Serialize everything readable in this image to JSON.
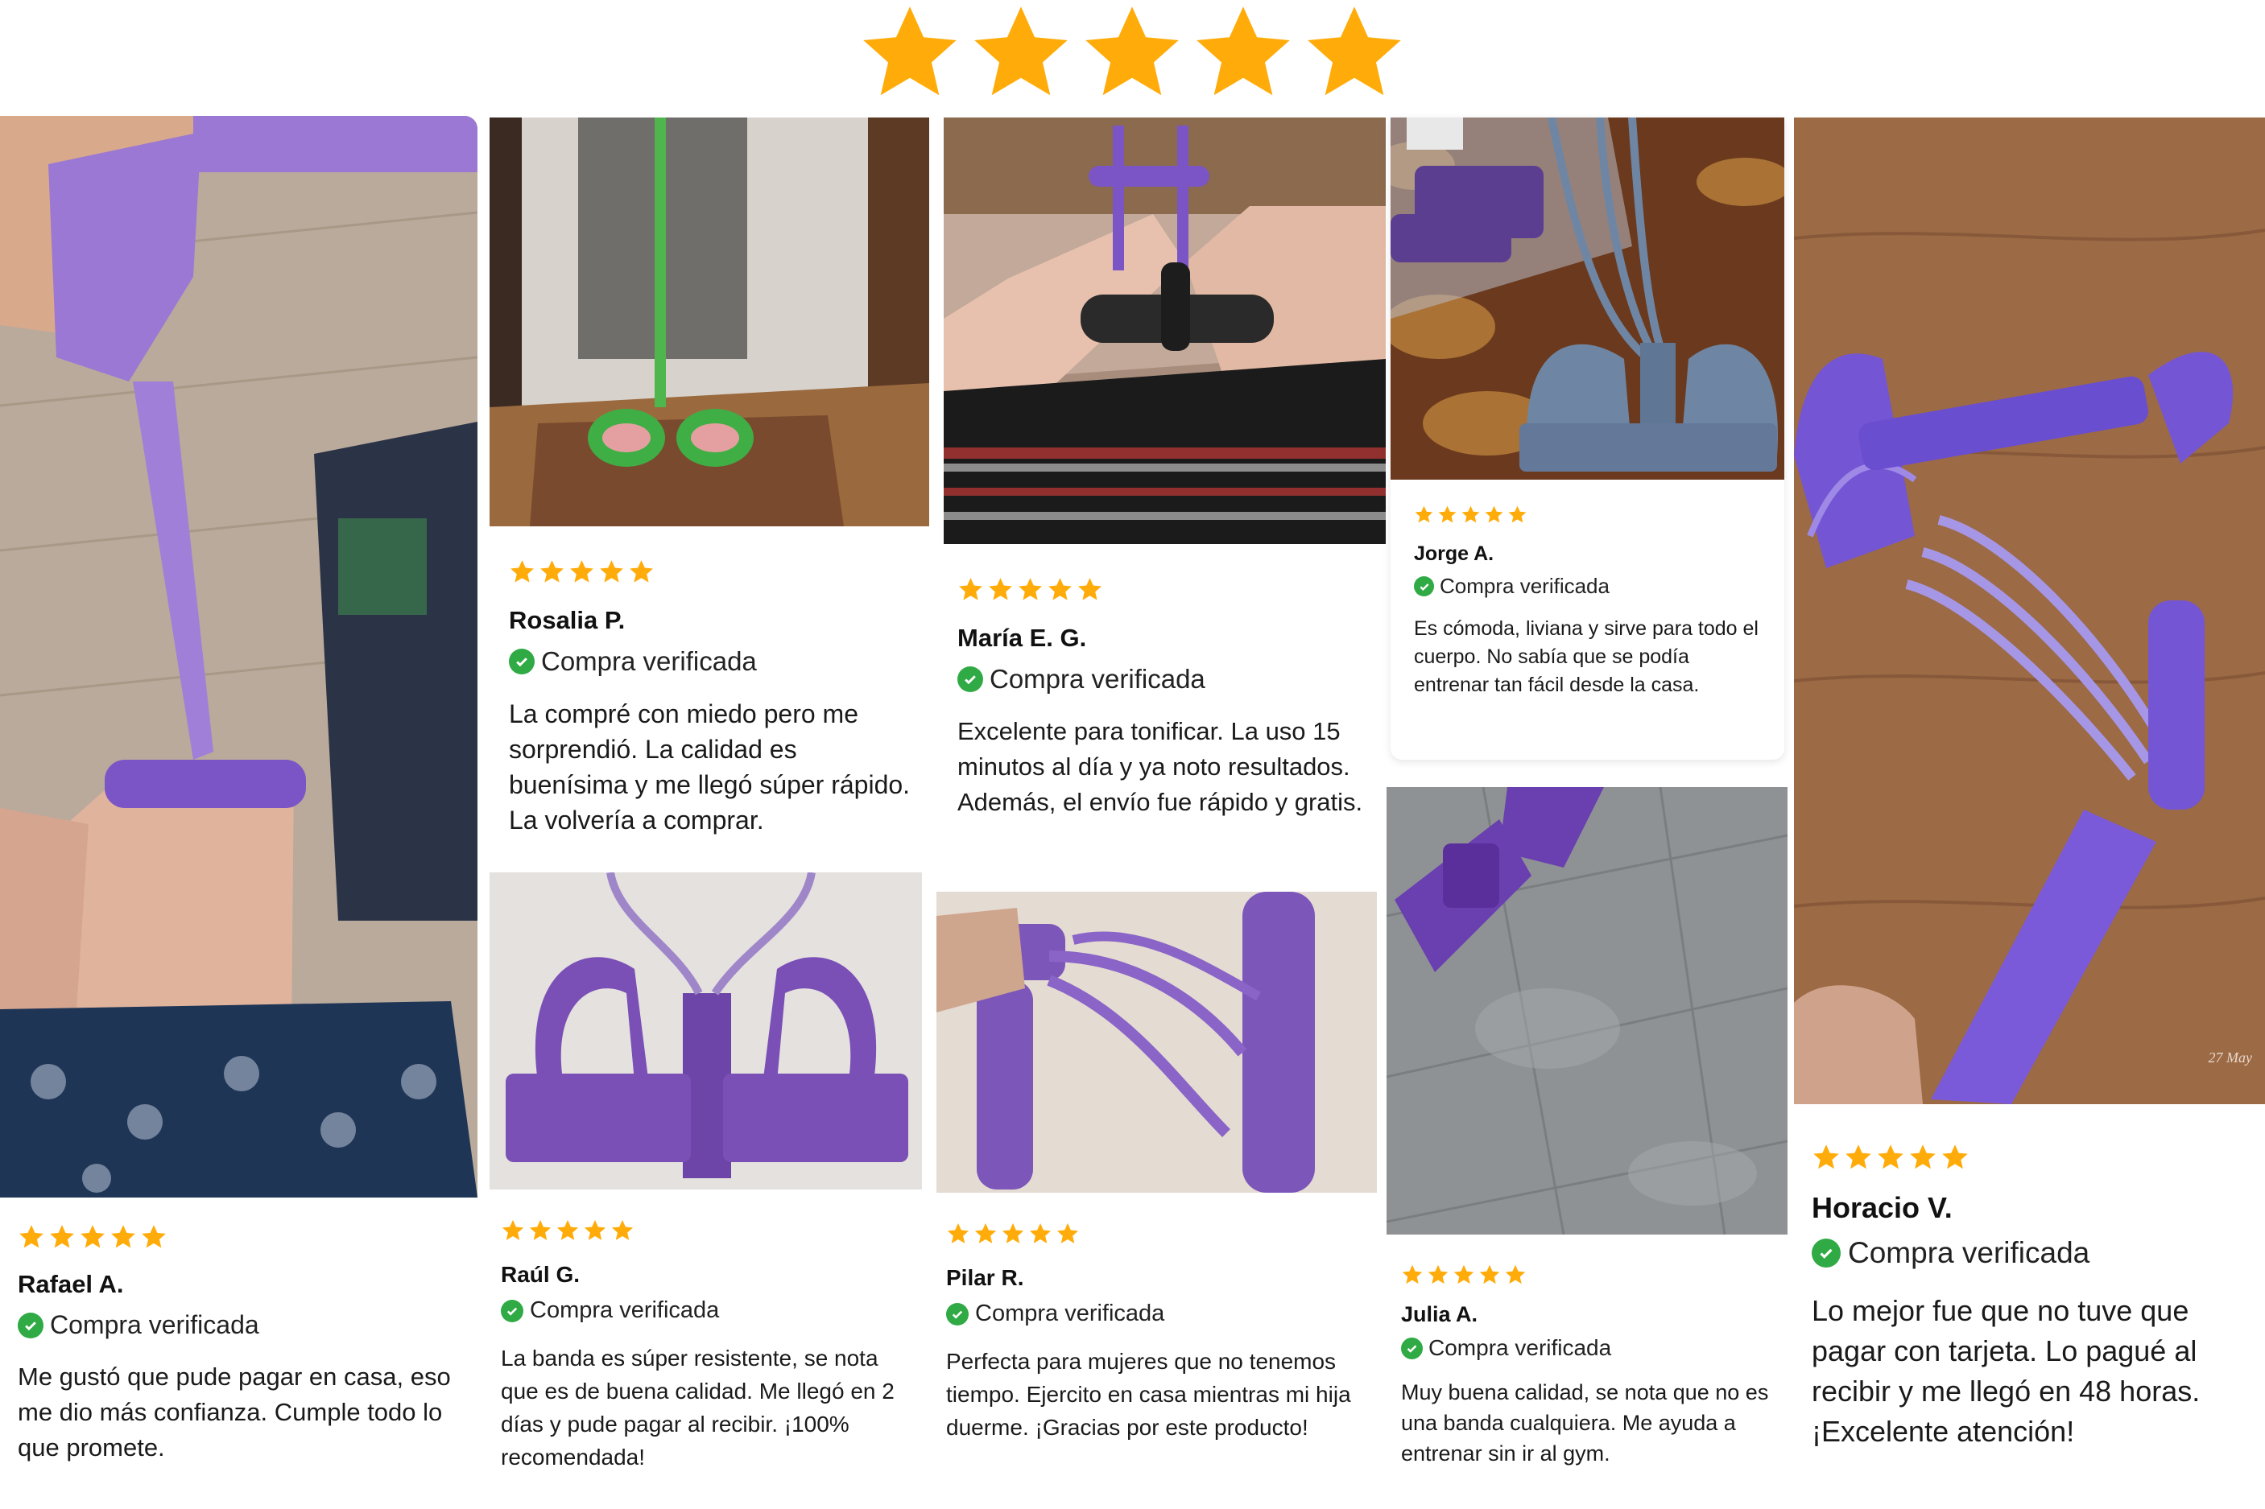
{
  "colors": {
    "star": "#FFAC0A",
    "verified": "#2FAA44",
    "purple": "#7C5BC9"
  },
  "top_rating": {
    "stars": 5,
    "icon": "star-icon"
  },
  "reviews": [
    {
      "rating": 5,
      "name": "Rafael A.",
      "verified": "Compra verificada",
      "text": "Me gustó que pude pagar en casa, eso me dio más confianza. Cumple todo lo que promete."
    },
    {
      "rating": 5,
      "name": "Rosalia P.",
      "verified": "Compra verificada",
      "text": "La compré con miedo pero me sorprendió. La calidad es buenísima y me llegó súper rápido. La volvería a comprar."
    },
    {
      "rating": 5,
      "name": "Raúl G.",
      "verified": "Compra verificada",
      "text": "La banda es súper resistente, se nota que es de buena calidad. Me llegó en 2 días y pude pagar al recibir. ¡100% recomendada!"
    },
    {
      "rating": 5,
      "name": "María E. G.",
      "verified": "Compra verificada",
      "text": "Excelente para tonificar. La uso 15 minutos al día y ya noto resultados. Además, el envío fue rápido y gratis."
    },
    {
      "rating": 5,
      "name": "Pilar R.",
      "verified": "Compra verificada",
      "text": "Perfecta para mujeres que no tenemos tiempo. Ejercito en casa mientras mi hija duerme. ¡Gracias por este producto!"
    },
    {
      "rating": 5,
      "name": "Jorge A.",
      "verified": "Compra verificada",
      "text": "Es cómoda, liviana y sirve para todo el cuerpo. No sabía que se podía entrenar tan fácil desde la casa."
    },
    {
      "rating": 5,
      "name": "Julia A.",
      "verified": "Compra verificada",
      "text": "Muy buena calidad, se nota que no es una banda cualquiera. Me ayuda a entrenar sin ir al gym."
    },
    {
      "rating": 5,
      "name": "Horacio V.",
      "verified": "Compra verificada",
      "text": "Lo mejor fue que no tuve que pagar con tarjeta. Lo pagué al recibir y me llegó en 48 horas. ¡Excelente atención!"
    }
  ],
  "photo_watermark": "27 May"
}
